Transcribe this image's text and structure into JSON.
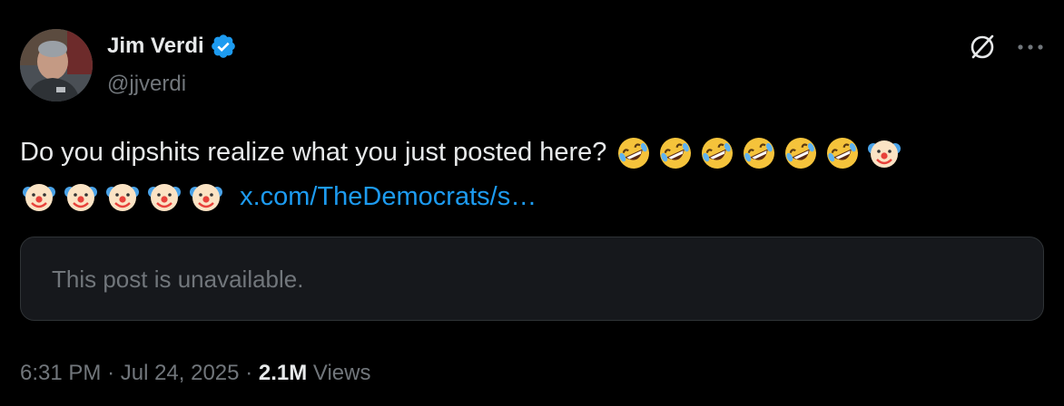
{
  "author": {
    "display_name": "Jim Verdi",
    "handle": "@jjverdi",
    "verified": true,
    "avatar_icon": "profile-photo"
  },
  "header_icons": {
    "grok": "grok-icon",
    "more": "more-icon"
  },
  "tweet": {
    "text": "Do you dipshits realize what you just posted here?",
    "emojis_line1": [
      "rofl",
      "rofl",
      "rofl",
      "rofl",
      "rofl",
      "rofl",
      "clown"
    ],
    "emojis_line2": [
      "clown",
      "clown",
      "clown",
      "clown",
      "clown"
    ],
    "link_text": "x.com/TheDemocrats/s…"
  },
  "quote": {
    "text": "This post is unavailable."
  },
  "meta": {
    "time": "6:31 PM",
    "separator1": "·",
    "date": "Jul 24, 2025",
    "separator2": "·",
    "views_count": "2.1M",
    "views_label": "Views"
  },
  "colors": {
    "background": "#000000",
    "text_primary": "#e7e9ea",
    "text_secondary": "#71767b",
    "link": "#1d9bf0",
    "verified": "#1d9bf0",
    "card_bg": "#16181c",
    "card_border": "#2f3336"
  }
}
